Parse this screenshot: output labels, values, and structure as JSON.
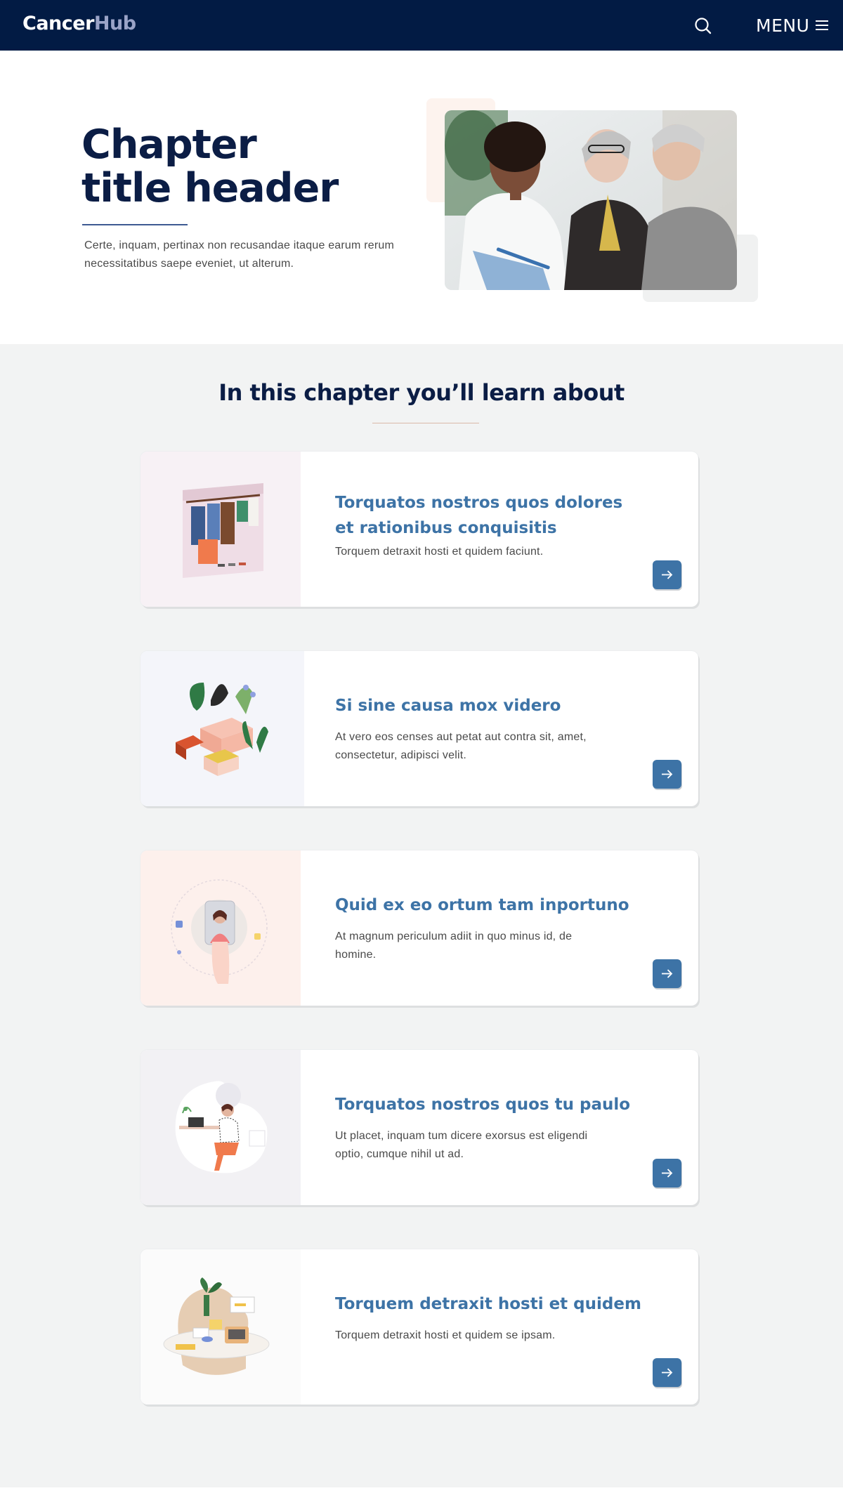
{
  "header": {
    "logo_part1": "Cancer",
    "logo_part2": "Hub",
    "menu_label": "MENU",
    "search_icon": "search-icon",
    "menu_icon": "hamburger-icon",
    "background": "#021b44"
  },
  "hero": {
    "title_line1": "Chapter",
    "title_line2": "title header",
    "description": "Certe, inquam, pertinax non recusandae itaque earum rerum necessitatibus saepe eveniet, ut alterum."
  },
  "learn": {
    "title": "In this chapter you’ll learn about",
    "cards": [
      {
        "title": "Torquatos nostros quos dolores et rationibus conquisitis",
        "description": "Torquem detraxit hosti et quidem faciunt.",
        "arrow_icon": "arrow-right-icon"
      },
      {
        "title": "Si sine causa mox videro",
        "description": "At vero eos censes aut petat aut contra sit, amet, consectetur, adipisci velit.",
        "arrow_icon": "arrow-right-icon"
      },
      {
        "title": "Quid ex eo ortum tam inportuno",
        "description": "At magnum periculum adiit in quo minus id, de homine.",
        "arrow_icon": "arrow-right-icon"
      },
      {
        "title": "Torquatos nostros quos tu paulo",
        "description": "Ut placet, inquam tum dicere exorsus est eligendi optio, cumque nihil ut ad.",
        "arrow_icon": "arrow-right-icon"
      },
      {
        "title": "Torquem detraxit hosti et quidem",
        "description": "Torquem detraxit hosti et quidem se ipsam.",
        "arrow_icon": "arrow-right-icon"
      }
    ]
  },
  "colors": {
    "navy": "#0b1d45",
    "accent": "#3d73a6",
    "page_bg": "#f2f3f3"
  }
}
